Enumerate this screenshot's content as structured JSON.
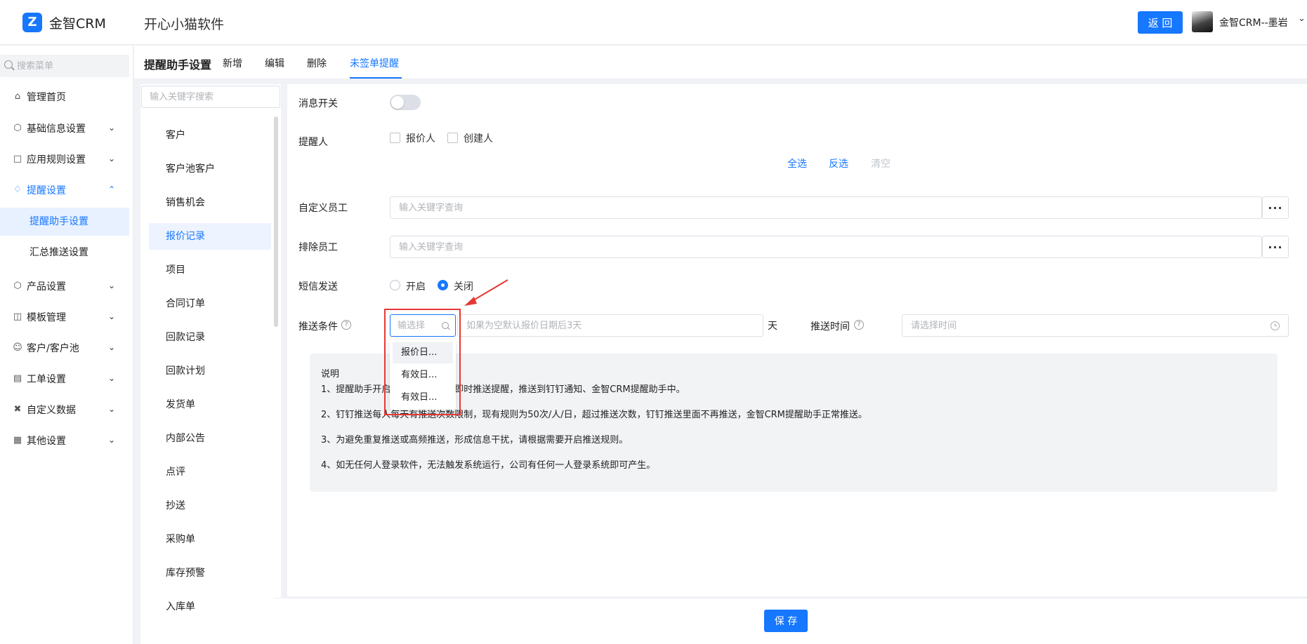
{
  "header": {
    "brand": "金智CRM",
    "company": "开心小猫软件",
    "back_label": "返 回",
    "user_name": "金智CRM--墨岩"
  },
  "sidebar": {
    "search_placeholder": "搜索菜单",
    "items": [
      {
        "label": "管理首页",
        "icon": "home-icon"
      },
      {
        "label": "基础信息设置",
        "icon": "cube-icon"
      },
      {
        "label": "应用规则设置",
        "icon": "document-icon"
      },
      {
        "label": "提醒设置",
        "icon": "bell-icon"
      },
      {
        "label": "产品设置",
        "icon": "cube-icon"
      },
      {
        "label": "模板管理",
        "icon": "template-icon"
      },
      {
        "label": "客户/客户池",
        "icon": "users-icon"
      },
      {
        "label": "工单设置",
        "icon": "ticket-icon"
      },
      {
        "label": "自定义数据",
        "icon": "tools-icon"
      },
      {
        "label": "其他设置",
        "icon": "grid-icon"
      }
    ],
    "sub_items": [
      {
        "label": "提醒助手设置"
      },
      {
        "label": "汇总推送设置"
      }
    ]
  },
  "tabs": {
    "title": "提醒助手设置",
    "items": [
      "新增",
      "编辑",
      "删除",
      "未签单提醒"
    ]
  },
  "categories": {
    "search_placeholder": "输入关键字搜索",
    "items": [
      "客户",
      "客户池客户",
      "销售机会",
      "报价记录",
      "项目",
      "合同订单",
      "回款记录",
      "回款计划",
      "发货单",
      "内部公告",
      "点评",
      "抄送",
      "采购单",
      "库存预警",
      "入库单"
    ]
  },
  "form": {
    "msg_switch_label": "消息开关",
    "reminder_label": "提醒人",
    "reminder_options": [
      "报价人",
      "创建人"
    ],
    "select_all": "全选",
    "invert": "反选",
    "clear": "清空",
    "custom_staff_label": "自定义员工",
    "custom_staff_placeholder": "输入关键字查询",
    "exclude_staff_label": "排除员工",
    "exclude_staff_placeholder": "输入关键字查询",
    "more_label": "···",
    "sms_label": "短信发送",
    "sms_options": [
      "开启",
      "关闭"
    ],
    "push_condition_label": "推送条件",
    "select_placeholder": "输选择",
    "days_placeholder": "如果为空默认报价日期后3天",
    "days_unit": "天",
    "push_time_label": "推送时间",
    "push_time_placeholder": "请选择时间",
    "dropdown_options": [
      "报价日...",
      "有效日...",
      "有效日..."
    ]
  },
  "note": {
    "title": "说明",
    "lines": [
      "1、提醒助手开启后，满足条件就即时推送提醒，推送到钉钉通知、金智CRM提醒助手中。",
      "2、钉钉推送每人每天有推送次数限制，现有规则为50次/人/日，超过推送次数，钉钉推送里面不再推送，金智CRM提醒助手正常推送。",
      "3、为避免重复推送或高频推送，形成信息干扰，请根据需要开启推送规则。",
      "4、如无任何人登录软件，无法触发系统运行，公司有任何一人登录系统即可产生。"
    ]
  },
  "footer": {
    "save_label": "保 存"
  },
  "colors": {
    "primary": "#1677ff",
    "highlight_box": "#e53935"
  }
}
